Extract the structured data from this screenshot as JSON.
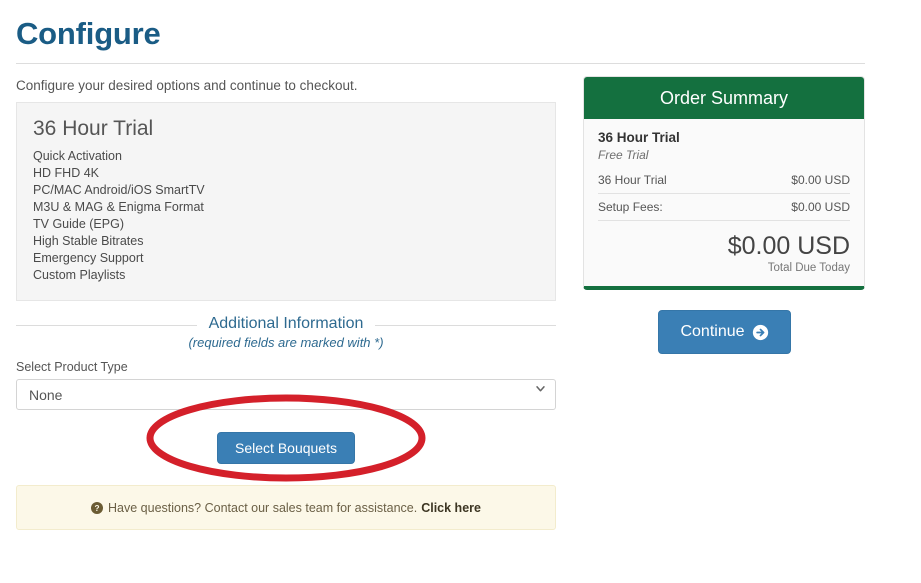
{
  "page": {
    "title": "Configure",
    "subtitle": "Configure your desired options and continue to checkout."
  },
  "product": {
    "name": "36 Hour Trial",
    "features": [
      "Quick Activation",
      "HD FHD 4K",
      "PC/MAC Android/iOS SmartTV",
      "M3U & MAG & Enigma Format",
      "TV Guide (EPG)",
      "High Stable Bitrates",
      "Emergency Support",
      "Custom Playlists"
    ]
  },
  "additional_information": {
    "heading": "Additional Information",
    "note": "(required fields are marked with *)",
    "field_label": "Select Product Type",
    "select_value": "None",
    "select_options": [
      "None"
    ],
    "select_bouquets_label": "Select Bouquets"
  },
  "help_banner": {
    "text": "Have questions? Contact our sales team for assistance.",
    "link_label": "Click here",
    "icon": "question-circle-icon"
  },
  "order_summary": {
    "header": "Order Summary",
    "product_name": "36 Hour Trial",
    "billing_term": "Free Trial",
    "rows": [
      {
        "label": "36 Hour Trial",
        "amount": "$0.00 USD"
      },
      {
        "label": "Setup Fees:",
        "amount": "$0.00 USD"
      }
    ],
    "total_amount": "$0.00 USD",
    "total_label": "Total Due Today"
  },
  "continue": {
    "label": "Continue",
    "icon": "arrow-circle-right-icon"
  },
  "annotation": {
    "shape": "ellipse",
    "color": "#d4202a",
    "target": "select-bouquets-button"
  },
  "colors": {
    "title_blue": "#1a5c85",
    "summary_green": "#14703f",
    "button_blue": "#3a7fb5",
    "banner_cream": "#fcf8e8",
    "annotation_red": "#d4202a"
  }
}
